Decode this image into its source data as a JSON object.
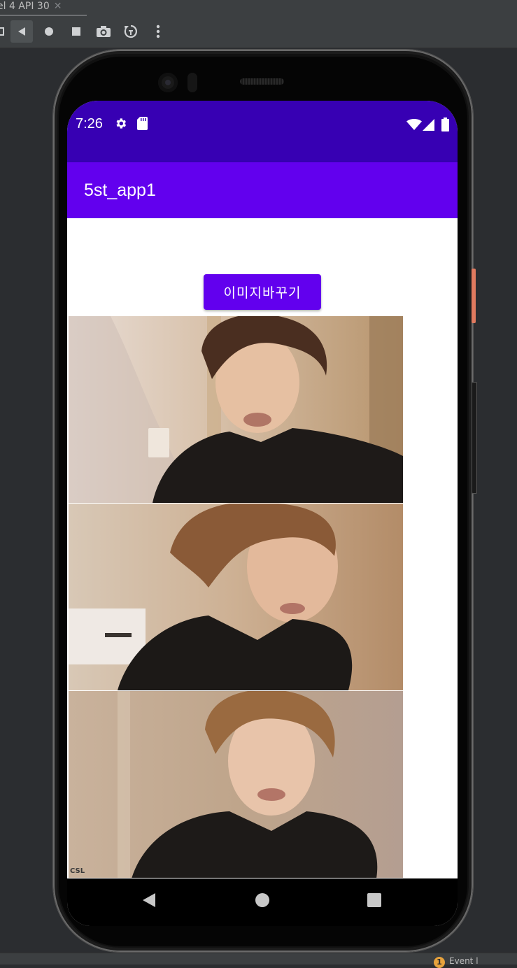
{
  "ide": {
    "tab_label": "el 4 API 30",
    "tab_close": "✕",
    "toolbar_icons": [
      "stop-square-icon",
      "back-icon",
      "home-icon",
      "overview-icon",
      "camera-icon",
      "rotate-icon",
      "more-icon"
    ],
    "footer_badge": "1",
    "footer_text": "Event l"
  },
  "status_bar": {
    "time": "7:26",
    "icons": [
      "gear-icon",
      "sd-card-icon",
      "wifi-icon",
      "cell-signal-icon",
      "battery-icon"
    ]
  },
  "app_bar": {
    "title": "5st_app1"
  },
  "content": {
    "change_image_button": "이미지바꾸기",
    "image_watermark": "CSL"
  },
  "nav_bar": {
    "icons": [
      "nav-back-icon",
      "nav-home-icon",
      "nav-recents-icon"
    ]
  },
  "colors": {
    "status_bar": "#3700b3",
    "app_bar": "#6200ee",
    "button": "#6200ee",
    "ide_background": "#2b2d30",
    "power_button": "#e07a5f"
  }
}
